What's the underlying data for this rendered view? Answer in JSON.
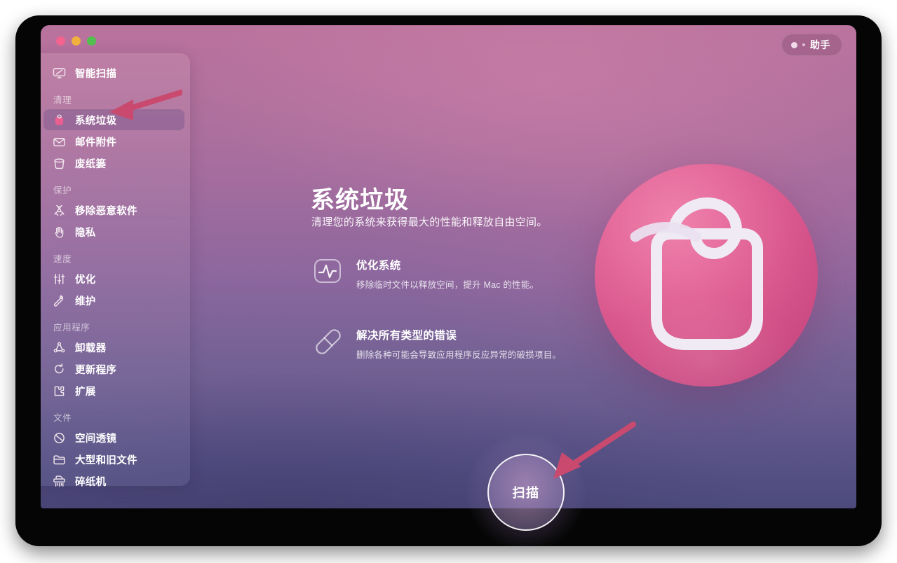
{
  "window": {
    "traffic_lights": [
      "close",
      "minimize",
      "zoom"
    ],
    "assistant_button": {
      "label": "助手",
      "icon": "assistant-dots-icon"
    }
  },
  "sidebar": {
    "top_item": {
      "label": "智能扫描",
      "icon": "smart-scan-monitor-icon"
    },
    "groups": [
      {
        "title": "清理",
        "items": [
          {
            "label": "系统垃圾",
            "icon": "trash-bag-icon",
            "selected": true
          },
          {
            "label": "邮件附件",
            "icon": "envelope-icon",
            "selected": false
          },
          {
            "label": "废纸篓",
            "icon": "trash-bin-icon",
            "selected": false
          }
        ]
      },
      {
        "title": "保护",
        "items": [
          {
            "label": "移除恶意软件",
            "icon": "biohazard-icon",
            "selected": false
          },
          {
            "label": "隐私",
            "icon": "hand-icon",
            "selected": false
          }
        ]
      },
      {
        "title": "速度",
        "items": [
          {
            "label": "优化",
            "icon": "sliders-icon",
            "selected": false
          },
          {
            "label": "维护",
            "icon": "wrench-icon",
            "selected": false
          }
        ]
      },
      {
        "title": "应用程序",
        "items": [
          {
            "label": "卸载器",
            "icon": "uninstaller-icon",
            "selected": false
          },
          {
            "label": "更新程序",
            "icon": "updater-refresh-icon",
            "selected": false
          },
          {
            "label": "扩展",
            "icon": "extensions-puzzle-icon",
            "selected": false
          }
        ]
      },
      {
        "title": "文件",
        "items": [
          {
            "label": "空间透镜",
            "icon": "space-lens-icon",
            "selected": false
          },
          {
            "label": "大型和旧文件",
            "icon": "folder-icon",
            "selected": false
          },
          {
            "label": "碎纸机",
            "icon": "shredder-icon",
            "selected": false
          }
        ]
      }
    ]
  },
  "main": {
    "title": "系统垃圾",
    "subtitle": "清理您的系统来获得最大的性能和释放自由空间。",
    "features": [
      {
        "title": "优化系统",
        "description": "移除临时文件以释放空间，提升 Mac 的性能。",
        "icon": "pulse-wave-icon"
      },
      {
        "title": "解决所有类型的错误",
        "description": "删除各种可能会导致应用程序反应异常的破损项目。",
        "icon": "capsule-pill-icon"
      }
    ],
    "artwork": {
      "icon": "trash-bag-sphere-illustration"
    },
    "scan_button": {
      "label": "扫描"
    }
  },
  "annotations": {
    "arrow_color": "#c94a6e",
    "arrows": [
      {
        "name": "arrow-to-system-junk",
        "points_to": "系统垃圾"
      },
      {
        "name": "arrow-to-scan-button",
        "points_to": "扫描"
      }
    ]
  }
}
